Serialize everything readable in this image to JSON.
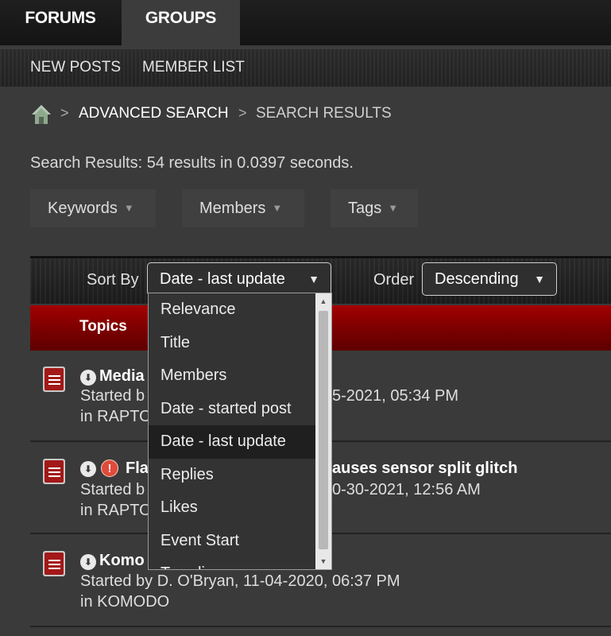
{
  "topnav": {
    "forums": "FORUMS",
    "groups": "GROUPS"
  },
  "subnav": {
    "new_posts": "NEW POSTS",
    "member_list": "MEMBER LIST"
  },
  "breadcrumb": {
    "sep": ">",
    "advanced_search": "ADVANCED SEARCH",
    "search_results": "SEARCH RESULTS"
  },
  "results_text": "Search Results: 54 results in 0.0397 seconds.",
  "filters": {
    "keywords": "Keywords",
    "members": "Members",
    "tags": "Tags"
  },
  "sort": {
    "label": "Sort By",
    "selected": "Date - last update",
    "options": [
      "Relevance",
      "Title",
      "Members",
      "Date - started post",
      "Date - last update",
      "Replies",
      "Likes",
      "Event Start",
      "Trending"
    ]
  },
  "order": {
    "label": "Order",
    "selected": "Descending"
  },
  "topics_header": "Topics",
  "rows": [
    {
      "title": "Media",
      "started": "Started b",
      "started_tail": "5-2021, 05:34 PM",
      "in": "in RAPTO"
    },
    {
      "title": "Fla",
      "title_tail": "auses sensor split glitch",
      "started": "Started b",
      "started_tail": "0-30-2021, 12:56 AM",
      "in": "in RAPTO"
    },
    {
      "title": "Komo",
      "started": "Started by D. O'Bryan, 11-04-2020, 06:37 PM",
      "in": "in KOMODO"
    }
  ],
  "icons": {
    "arrow": "▼",
    "down_circle": "⬇",
    "alert": "!"
  },
  "colors": {
    "accent_red": "#8a0000",
    "background": "#3a3a3a"
  }
}
